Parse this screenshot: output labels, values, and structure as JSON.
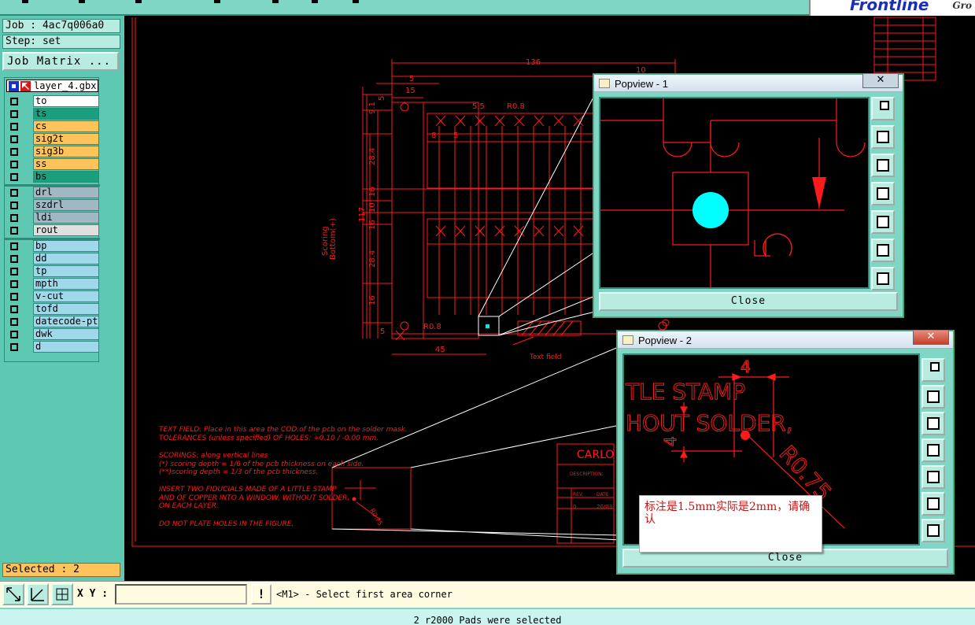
{
  "header": {
    "logo_text": "Frontline",
    "logo_sub": "Gro"
  },
  "job": {
    "job_line": "Job : 4ac7q006a0",
    "step_line": "Step: set",
    "matrix_button": "Job Matrix ..."
  },
  "layers": {
    "current": "layer_4.gbx",
    "groups": [
      [
        {
          "name": "to",
          "color": "#ffffff"
        },
        {
          "name": "ts",
          "color": "#1a9e7e"
        },
        {
          "name": "cs",
          "color": "#ffc35c"
        },
        {
          "name": "sig2t",
          "color": "#ffc35c"
        },
        {
          "name": "sig3b",
          "color": "#ffc35c"
        },
        {
          "name": "ss",
          "color": "#ffc35c"
        },
        {
          "name": "bs",
          "color": "#1a9e7e"
        }
      ],
      [
        {
          "name": "drl",
          "color": "#9fb8c4"
        },
        {
          "name": "szdrl",
          "color": "#9fb8c4"
        },
        {
          "name": "ldi",
          "color": "#9fb8c4"
        },
        {
          "name": "rout",
          "color": "#e0e0e0"
        }
      ],
      [
        {
          "name": "bp",
          "color": "#9fd8e8"
        },
        {
          "name": "dd",
          "color": "#9fd8e8"
        },
        {
          "name": "tp",
          "color": "#9fd8e8"
        },
        {
          "name": "mpth",
          "color": "#9fd8e8"
        },
        {
          "name": "v-cut",
          "color": "#9fd8e8"
        },
        {
          "name": "tofd",
          "color": "#9fd8e8"
        },
        {
          "name": "datecode-ptc",
          "color": "#9fd8e8"
        },
        {
          "name": "dwk",
          "color": "#9fd8e8"
        },
        {
          "name": "d",
          "color": "#9fd8e8"
        }
      ]
    ]
  },
  "selected": "Selected : 2",
  "bottom": {
    "xy_label": "X Y :",
    "xy_value": "",
    "message": "<M1> - Select first area corner"
  },
  "status": "2 r2000 Pads were selected",
  "drawing": {
    "dims": {
      "d136": "136",
      "d10": "10",
      "d5a": "5",
      "d15": "15",
      "d55": "5.5",
      "d8": "8",
      "d5b": "5",
      "r08a": "R0.8",
      "r08b": "R0.8",
      "d91": "9.1",
      "d5c": "5",
      "d284a": "28.4",
      "d16a": "16",
      "d117": "117",
      "d10b": "10",
      "d16b": "16",
      "d284b": "28.4",
      "d16c": "16",
      "d5d": "5",
      "d45": "45"
    },
    "scoring_1": "Scoring",
    "scoring_2": "Bottom(+)",
    "text_field": "Text field",
    "notes": [
      "TEXT FIELD: Place in this area the COD.of the pcb on the solder mask.",
      "TOLERANCES (unless specified) OF HOLES: +0.10 / -0.00 mm.",
      "SCORINGS: along vertical lines",
      "(*) scoring depth = 1/6 of the pcb thickness on each side.",
      "(**)scoring depth = 1/3 of the pcb thickness.",
      "INSERT TWO FIDUCIALS MADE OF A LITTLE STAMP",
      "AND OF COPPER INTO A WINDOW, WITHOUT SOLDER,",
      "ON EACH LAYER.",
      "DO NOT PLATE HOLES IN THE FIGURE."
    ],
    "title_block": {
      "name": "CARLO",
      "description": "DESCRIPTION:",
      "rev": "REV.",
      "date": "DATE",
      "rev_val": "0",
      "date_val": "20/03"
    },
    "zoom_dim": "R0.75"
  },
  "popview1": {
    "title": "Popview - 1",
    "close_label": "Close"
  },
  "popview2": {
    "title": "Popview - 2",
    "close_label": "Close",
    "dim_4": "4",
    "dim_4b": "4",
    "text_1": "TLE STAMP",
    "text_2": "HOUT SOLDER,",
    "text_r": "R0.75"
  },
  "note": {
    "text": "标注是1.5mm实际是2mm，请确认"
  },
  "colors": {
    "panel": "#5fc8b2",
    "drawing": "#ff1a1a",
    "pad": "#00e5ee",
    "note_text": "#d01010"
  }
}
